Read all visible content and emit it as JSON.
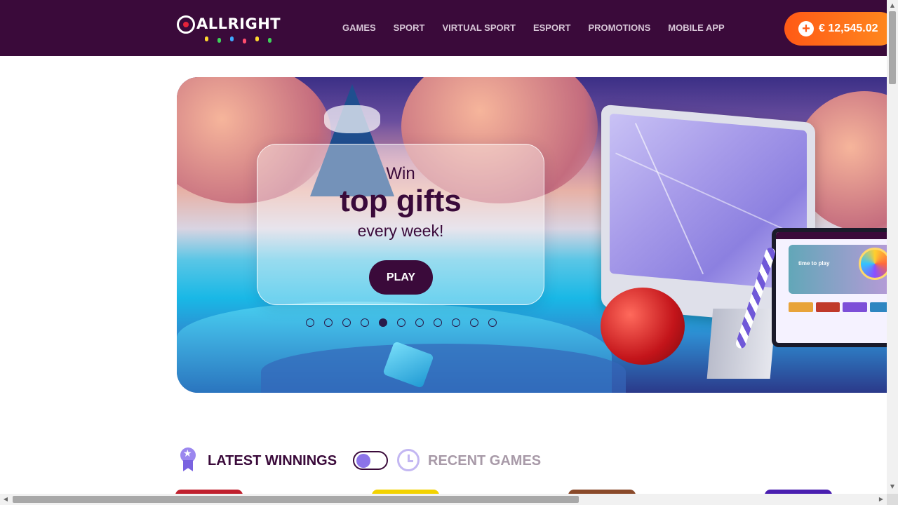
{
  "header": {
    "logo_text": "ALLRIGHT",
    "nav": [
      "GAMES",
      "SPORT",
      "VIRTUAL SPORT",
      "ESPORT",
      "PROMOTIONS",
      "MOBILE APP"
    ],
    "balance": "€ 12,545.02",
    "plus_symbol": "+"
  },
  "banner": {
    "line1": "Win",
    "line2": "top gifts",
    "line3": "every week!",
    "button": "PLAY",
    "dot_count": 11,
    "active_dot": 5,
    "laptop_text": "time to play"
  },
  "winnings": {
    "latest_label": "LATEST WINNINGS",
    "recent_label": "RECENT GAMES",
    "toggle_on": true
  },
  "scrollbars": {
    "up": "▲",
    "down": "▼",
    "left": "◀",
    "right": "▶"
  },
  "colors": {
    "header_bg": "#3a0a3a",
    "accent": "#ff6a1a",
    "primary_text": "#3a0a3a"
  }
}
